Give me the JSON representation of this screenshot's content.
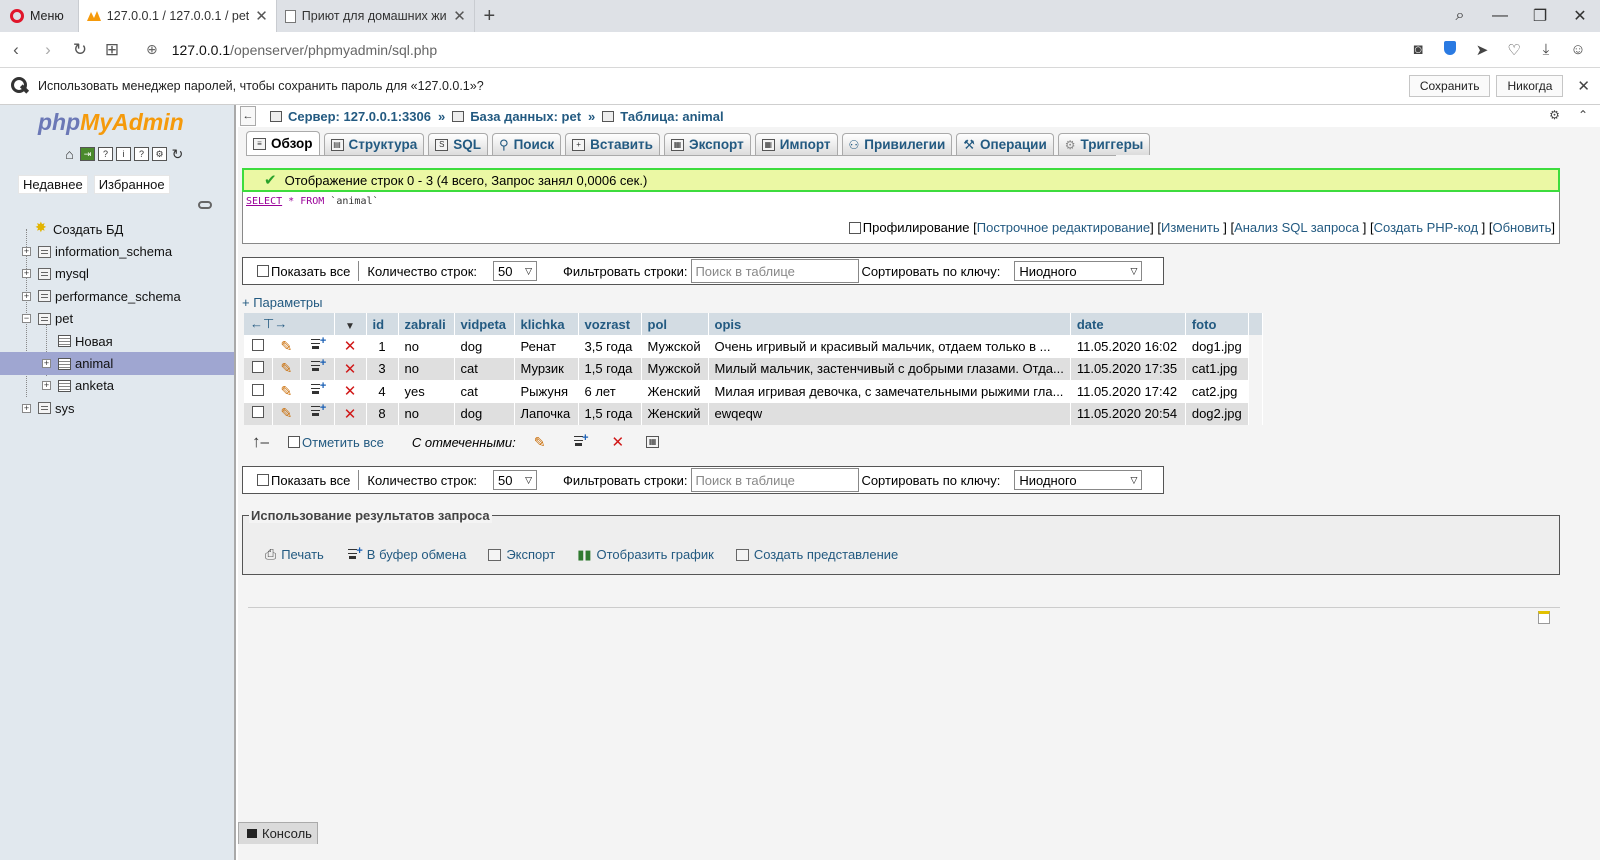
{
  "browser": {
    "menu_label": "Меню",
    "tabs": [
      {
        "title": "127.0.0.1 / 127.0.0.1 / pet /",
        "active": true
      },
      {
        "title": "Приют для домашних жи",
        "active": false
      }
    ],
    "address": {
      "host": "127.0.0.1",
      "path": "/openserver/phpmyadmin/sql.php"
    },
    "password_bar": {
      "text": "Использовать менеджер паролей, чтобы сохранить пароль для «127.0.0.1»?",
      "save_label": "Сохранить",
      "never_label": "Никогда"
    }
  },
  "sidebar": {
    "logo_php": "php",
    "logo_myadmin": "MyAdmin",
    "recent_label": "Недавнее",
    "favorites_label": "Избранное",
    "tree": {
      "create_db": "Создать БД",
      "information_schema": "information_schema",
      "mysql": "mysql",
      "performance_schema": "performance_schema",
      "pet": "pet",
      "new_table": "Новая",
      "animal": "animal",
      "anketa": "anketa",
      "sys": "sys"
    }
  },
  "breadcrumb": {
    "server": "Сервер: 127.0.0.1:3306",
    "database": "База данных: pet",
    "table": "Таблица: animal"
  },
  "tabs": {
    "browse": "Обзор",
    "structure": "Структура",
    "sql": "SQL",
    "search": "Поиск",
    "insert": "Вставить",
    "export": "Экспорт",
    "import": "Импорт",
    "privileges": "Привилегии",
    "operations": "Операции",
    "triggers": "Триггеры"
  },
  "result": {
    "message": "Отображение строк 0 - 3 (4 всего, Запрос занял 0,0006 сек.)",
    "sql": {
      "select": "SELECT",
      "star": "*",
      "from": "FROM",
      "table": "`animal`"
    },
    "profiling": "Профилирование",
    "links": {
      "inline_edit": "Построчное редактирование",
      "edit": "Изменить",
      "explain": "Анализ SQL запроса",
      "php_code": "Создать PHP-код",
      "refresh": "Обновить"
    }
  },
  "navigation": {
    "show_all": "Показать все",
    "rows_label": "Количество строк:",
    "rows_value": "50",
    "filter_label": "Фильтровать строки:",
    "filter_placeholder": "Поиск в таблице",
    "sort_label": "Сортировать по ключу:",
    "sort_value": "Ниодного"
  },
  "options_link": "+ Параметры",
  "table": {
    "columns": [
      "id",
      "zabrali",
      "vidpeta",
      "klichka",
      "vozrast",
      "pol",
      "opis",
      "date",
      "foto"
    ],
    "rows": [
      {
        "id": "1",
        "zabrali": "no",
        "vidpeta": "dog",
        "klichka": "Ренат",
        "vozrast": "3,5 года",
        "pol": "Мужской",
        "opis": "Очень игривый и красивый мальчик, отдаем только в ...",
        "date": "11.05.2020 16:02",
        "foto": "dog1.jpg"
      },
      {
        "id": "3",
        "zabrali": "no",
        "vidpeta": "cat",
        "klichka": "Мурзик",
        "vozrast": "1,5 года",
        "pol": "Мужской",
        "opis": "Милый мальчик, застенчивый с добрыми глазами. Отда...",
        "date": "11.05.2020 17:35",
        "foto": "cat1.jpg"
      },
      {
        "id": "4",
        "zabrali": "yes",
        "vidpeta": "cat",
        "klichka": "Рыжуня",
        "vozrast": "6 лет",
        "pol": "Женский",
        "opis": "Милая игривая девочка, с замечательными рыжими гла...",
        "date": "11.05.2020 17:42",
        "foto": "cat2.jpg"
      },
      {
        "id": "8",
        "zabrali": "no",
        "vidpeta": "dog",
        "klichka": "Лапочка",
        "vozrast": "1,5 года",
        "pol": "Женский",
        "opis": "ewqeqw",
        "date": "11.05.2020 20:54",
        "foto": "dog2.jpg"
      }
    ]
  },
  "bulk": {
    "check_all": "Отметить все",
    "with_selected": "С отмеченными:"
  },
  "query_results": {
    "legend": "Использование результатов запроса",
    "print": "Печать",
    "clipboard": "В буфер обмена",
    "export": "Экспорт",
    "chart": "Отобразить график",
    "view": "Создать представление"
  },
  "console_label": "Консоль"
}
